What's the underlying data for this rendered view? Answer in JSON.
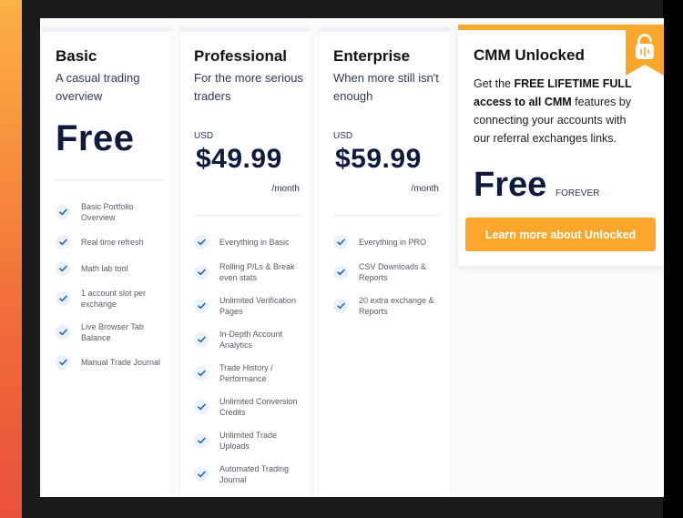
{
  "colors": {
    "accent": "#fba72b",
    "price_text": "#0e1b3f",
    "check_icon": "#1a5fb4",
    "check_bg": "#e9f1fc"
  },
  "plans": [
    {
      "name": "Basic",
      "subtitle": "A casual trading overview",
      "price": "Free",
      "features": [
        "Basic Portfolio Overview",
        "Real time refresh",
        "Math lab tool",
        "1 account slot per exchange",
        "Live Browser Tab Balance",
        "Manual Trade Journal"
      ]
    },
    {
      "name": "Professional",
      "subtitle": "For the more serious traders",
      "currency": "USD",
      "price": "$49.99",
      "period": "/month",
      "features": [
        "Everything in Basic",
        "Rolling P/Ls & Break even stats",
        "Unlimited Verification Pages",
        "In-Depth Account Analytics",
        "Trade History / Performance",
        "Unlimited Conversion Credits",
        "Unlimited Trade Uploads",
        "Automated Trading Journal"
      ]
    },
    {
      "name": "Enterprise",
      "subtitle": "When more still isn't enough",
      "currency": "USD",
      "price": "$59.99",
      "period": "/month",
      "features": [
        "Everything in PRO",
        "CSV Downloads & Reports",
        "20 extra exchange & Reports"
      ]
    }
  ],
  "unlocked": {
    "title": "CMM Unlocked",
    "desc_pre": "Get the ",
    "desc_bold": "FREE LIFETIME FULL access to all CMM",
    "desc_post": " features by connecting your accounts with our referral exchanges links.",
    "price": "Free",
    "price_suffix": "FOREVER",
    "button_label": "Learn more about Unlocked",
    "badge_icon": "unlock-chart-icon"
  }
}
